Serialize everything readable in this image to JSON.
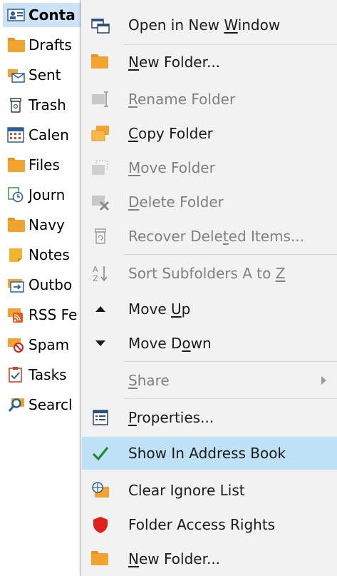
{
  "folder_pane": {
    "items": [
      {
        "label": "Conta",
        "icon": "contacts-icon"
      },
      {
        "label": "Drafts",
        "icon": "folder-icon"
      },
      {
        "label": "Sent",
        "icon": "sent-icon"
      },
      {
        "label": "Trash",
        "icon": "trash-icon"
      },
      {
        "label": "Calen",
        "icon": "calendar-icon"
      },
      {
        "label": "Files",
        "icon": "folder-icon"
      },
      {
        "label": "Journ",
        "icon": "journal-icon"
      },
      {
        "label": "Navy",
        "icon": "folder-icon"
      },
      {
        "label": "Notes",
        "icon": "notes-icon"
      },
      {
        "label": "Outbo",
        "icon": "outbox-icon"
      },
      {
        "label": "RSS Fe",
        "icon": "rss-icon"
      },
      {
        "label": "Spam",
        "icon": "spam-icon"
      },
      {
        "label": "Tasks",
        "icon": "tasks-icon"
      },
      {
        "label": "Searcl",
        "icon": "search-folder-icon"
      }
    ]
  },
  "context_menu": {
    "items": [
      {
        "pre": "Open in New ",
        "u": "W",
        "post": "indow",
        "icon": "new-window-icon",
        "enabled": true
      },
      {
        "pre": "",
        "u": "N",
        "post": "ew Folder...",
        "icon": "folder-icon",
        "enabled": true
      },
      {
        "pre": "",
        "u": "R",
        "post": "ename Folder",
        "icon": "rename-folder-icon",
        "enabled": false
      },
      {
        "pre": "",
        "u": "C",
        "post": "opy Folder",
        "icon": "copy-folder-icon",
        "enabled": true
      },
      {
        "pre": "",
        "u": "M",
        "post": "ove Folder",
        "icon": "move-folder-icon",
        "enabled": false
      },
      {
        "pre": "",
        "u": "D",
        "post": "elete Folder",
        "icon": "delete-folder-icon",
        "enabled": false
      },
      {
        "pre": "Recover Dele",
        "u": "t",
        "post": "ed Items...",
        "icon": "recover-deleted-icon",
        "enabled": false
      },
      {
        "pre": "Sort Subfolders A to ",
        "u": "Z",
        "post": "",
        "icon": "sort-az-icon",
        "enabled": false
      },
      {
        "pre": "Move ",
        "u": "U",
        "post": "p",
        "icon": "move-up-icon",
        "enabled": true
      },
      {
        "pre": "Move D",
        "u": "o",
        "post": "wn",
        "icon": "move-down-icon",
        "enabled": true
      },
      {
        "pre": "",
        "u": "S",
        "post": "hare",
        "icon": "",
        "enabled": false,
        "submenu": true
      },
      {
        "pre": "",
        "u": "P",
        "post": "roperties...",
        "icon": "properties-icon",
        "enabled": true
      },
      {
        "pre": "Show In Address Book",
        "u": "",
        "post": "",
        "icon": "checkmark-icon",
        "enabled": true,
        "highlighted": true
      },
      {
        "pre": "Clear Ignore List",
        "u": "",
        "post": "",
        "icon": "clear-ignore-icon",
        "enabled": true
      },
      {
        "pre": "Folder Access Rights",
        "u": "",
        "post": "",
        "icon": "shield-icon",
        "enabled": true
      },
      {
        "pre": "",
        "u": "N",
        "post": "ew Folder...",
        "icon": "folder-icon",
        "enabled": true
      }
    ]
  },
  "colors": {
    "menu_bg": "#f2f2f2",
    "highlight": "#bfe1f6",
    "disabled_text": "#808080",
    "folder": "#f2a330",
    "check": "#1e8a3a",
    "shield": "#e0201b"
  }
}
